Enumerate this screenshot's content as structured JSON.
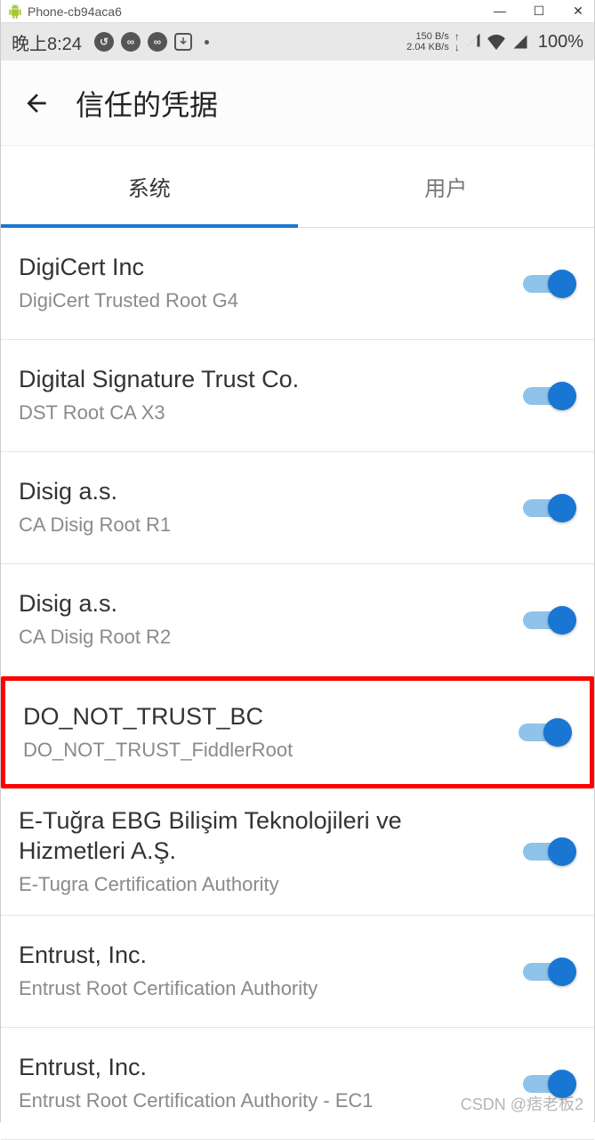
{
  "window": {
    "title": "Phone-cb94aca6"
  },
  "status_bar": {
    "time": "晚上8:24",
    "net_up": "150 B/s",
    "net_down": "2.04 KB/s",
    "battery": "100%"
  },
  "action_bar": {
    "title": "信任的凭据"
  },
  "tabs": {
    "system": "系统",
    "user": "用户"
  },
  "certs": [
    {
      "name": "DigiCert Inc",
      "sub": "DigiCert Trusted Root G4",
      "on": true,
      "hl": false
    },
    {
      "name": "Digital Signature Trust Co.",
      "sub": "DST Root CA X3",
      "on": true,
      "hl": false
    },
    {
      "name": "Disig a.s.",
      "sub": "CA Disig Root R1",
      "on": true,
      "hl": false
    },
    {
      "name": "Disig a.s.",
      "sub": "CA Disig Root R2",
      "on": true,
      "hl": false
    },
    {
      "name": "DO_NOT_TRUST_BC",
      "sub": "DO_NOT_TRUST_FiddlerRoot",
      "on": true,
      "hl": true
    },
    {
      "name": "E-Tuğra EBG Bilişim Teknolojileri ve Hizmetleri A.Ş.",
      "sub": "E-Tugra Certification Authority",
      "on": true,
      "hl": false
    },
    {
      "name": "Entrust, Inc.",
      "sub": "Entrust Root Certification Authority",
      "on": true,
      "hl": false
    },
    {
      "name": "Entrust, Inc.",
      "sub": "Entrust Root Certification Authority - EC1",
      "on": true,
      "hl": false
    }
  ],
  "watermark": "CSDN @痞老板2"
}
